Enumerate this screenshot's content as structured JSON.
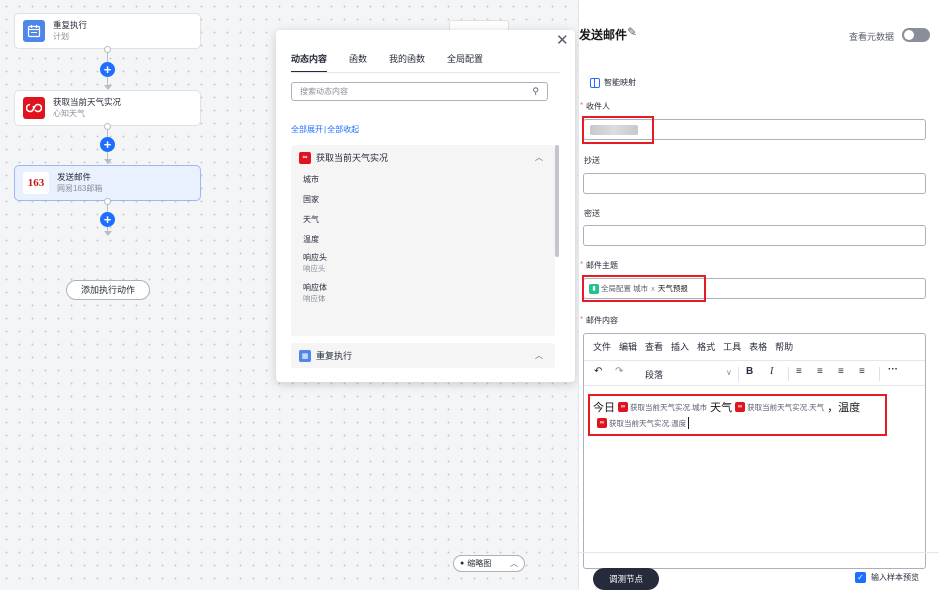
{
  "nodes": [
    {
      "title": "重复执行",
      "subtitle": "计划"
    },
    {
      "title": "获取当前天气实况",
      "subtitle": "心知天气"
    },
    {
      "title": "发送邮件",
      "subtitle": "网易163邮箱",
      "logo_text": "163"
    }
  ],
  "add_action_label": "添加执行动作",
  "minimap_label": "缩略图",
  "popover": {
    "tabs": [
      "动态内容",
      "函数",
      "我的函数",
      "全局配置"
    ],
    "active_tab": "动态内容",
    "search_placeholder": "搜索动态内容",
    "expand_all": "全部展开",
    "divider": "|",
    "collapse_all": "全部收起",
    "groups": [
      {
        "name": "获取当前天气实况",
        "items": [
          {
            "label": "城市"
          },
          {
            "label": "国家"
          },
          {
            "label": "天气"
          },
          {
            "label": "温度"
          },
          {
            "label": "响应头",
            "sub": "响应头"
          },
          {
            "label": "响应体",
            "sub": "响应体"
          }
        ]
      },
      {
        "name": "重复执行"
      }
    ]
  },
  "panel": {
    "title": "发送邮件",
    "view_metadata": "查看元数据",
    "smart_mapping": "智能映射",
    "fields": {
      "to": {
        "label": "收件人",
        "required_mark": "*"
      },
      "cc": {
        "label": "抄送"
      },
      "bcc": {
        "label": "密送"
      },
      "subject": {
        "label": "邮件主题",
        "required_mark": "*",
        "chip_source": "全局配置",
        "chip_field": "城市",
        "sep": "x",
        "text": "天气预报"
      },
      "body": {
        "label": "邮件内容",
        "required_mark": "*"
      }
    },
    "editor": {
      "menu": [
        "文件",
        "编辑",
        "查看",
        "插入",
        "格式",
        "工具",
        "表格",
        "帮助"
      ],
      "paragraph": "段落",
      "line1": {
        "t1": "今日",
        "chip1": "获取当前天气实况.城市",
        "t2": "天气",
        "chip2": "获取当前天气实况.天气",
        "t3": "，温度"
      },
      "line2": {
        "chip3": "获取当前天气实况.温度"
      }
    },
    "debug_button": "调测节点",
    "preview_label": "输入样本预览",
    "preview_checked": true
  },
  "colors": {
    "primary": "#1e6fff",
    "highlight": "#e51c23",
    "weather_brand": "#e0141f",
    "dark_button": "#252b3a"
  }
}
